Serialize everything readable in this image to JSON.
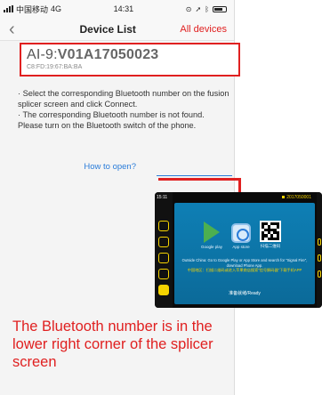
{
  "status_bar": {
    "carrier": "中国移动",
    "network": "4G",
    "time": "14:31"
  },
  "nav": {
    "back_glyph": "‹",
    "title": "Device List",
    "action": "All devices"
  },
  "device": {
    "name_prefix": "AI-9:",
    "name_bold": "V01A17050023",
    "mac": "C8:FD:19:67:BA:BA"
  },
  "instructions": {
    "line1": "· Select the corresponding Bluetooth number on the fusion splicer screen and click Connect.",
    "line2": "· The corresponding Bluetooth number is not found. Please turn on the Bluetooth switch of the phone."
  },
  "howto_link": "How to open?",
  "splicer": {
    "time": "15:11",
    "bt_id": "2017050001",
    "icon_google": "Google play",
    "icon_appstore": "App store",
    "icon_qr": "扫描二维码",
    "text_en": "Outside China: Go to Google Play or App Store and search for \"Signal Fire\", download Phone App.",
    "text_cn": "中国地区：扫描二维码或进入苹果商店搜索\"信号解码器\"下载手机APP",
    "ready": "准备就绪/Ready"
  },
  "caption": "The Bluetooth number is in the lower right corner of the splicer screen",
  "colors": {
    "accent_red": "#e02020",
    "link_blue": "#2a7cd9",
    "splicer_yellow": "#f5d300"
  }
}
